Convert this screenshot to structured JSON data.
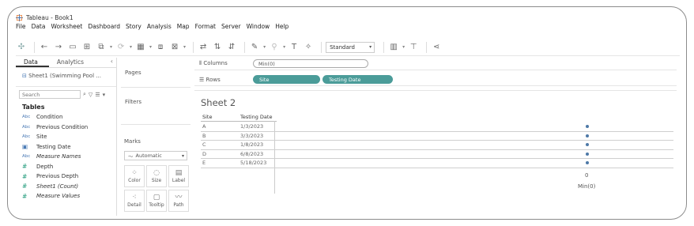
{
  "window": {
    "title": "Tableau - Book1"
  },
  "menu": [
    "File",
    "Data",
    "Worksheet",
    "Dashboard",
    "Story",
    "Analysis",
    "Map",
    "Format",
    "Server",
    "Window",
    "Help"
  ],
  "toolbar": {
    "fit_select": "Standard"
  },
  "data_pane": {
    "tabs": [
      "Data",
      "Analytics"
    ],
    "datasource": "Sheet1 (Swimming Pool ...",
    "search_placeholder": "Search",
    "tables_heading": "Tables",
    "fields": [
      {
        "type": "Abc",
        "kind": "dim",
        "name": "Condition",
        "italic": false
      },
      {
        "type": "Abc",
        "kind": "dim",
        "name": "Previous Condition",
        "italic": false
      },
      {
        "type": "Abc",
        "kind": "dim",
        "name": "Site",
        "italic": false
      },
      {
        "type": "date",
        "kind": "date",
        "name": "Testing Date",
        "italic": false
      },
      {
        "type": "Abc",
        "kind": "dim",
        "name": "Measure Names",
        "italic": true
      },
      {
        "type": "#",
        "kind": "meas",
        "name": "Depth",
        "italic": false
      },
      {
        "type": "#",
        "kind": "meas",
        "name": "Previous Depth",
        "italic": false
      },
      {
        "type": "#",
        "kind": "meas",
        "name": "Sheet1 (Count)",
        "italic": true
      },
      {
        "type": "#",
        "kind": "meas",
        "name": "Measure Values",
        "italic": true
      }
    ]
  },
  "cards": {
    "pages": "Pages",
    "filters": "Filters",
    "marks": "Marks",
    "marks_type": "Automatic",
    "mark_buttons": [
      "Color",
      "Size",
      "Label",
      "Detail",
      "Tooltip",
      "Path"
    ]
  },
  "shelves": {
    "columns_label": "Columns",
    "columns_pill": "Min(0)",
    "rows_label": "Rows",
    "rows_pills": [
      "Site",
      "Testing Date"
    ]
  },
  "view": {
    "sheet_title": "Sheet 2",
    "col_headers": [
      "Site",
      "Testing Date"
    ],
    "rows": [
      {
        "site": "A",
        "date": "1/3/2023"
      },
      {
        "site": "B",
        "date": "3/3/2023"
      },
      {
        "site": "C",
        "date": "1/8/2023"
      },
      {
        "site": "D",
        "date": "6/8/2023"
      },
      {
        "site": "E",
        "date": "5/18/2023"
      }
    ],
    "axis_tick": "0",
    "axis_title": "Min(0)"
  }
}
